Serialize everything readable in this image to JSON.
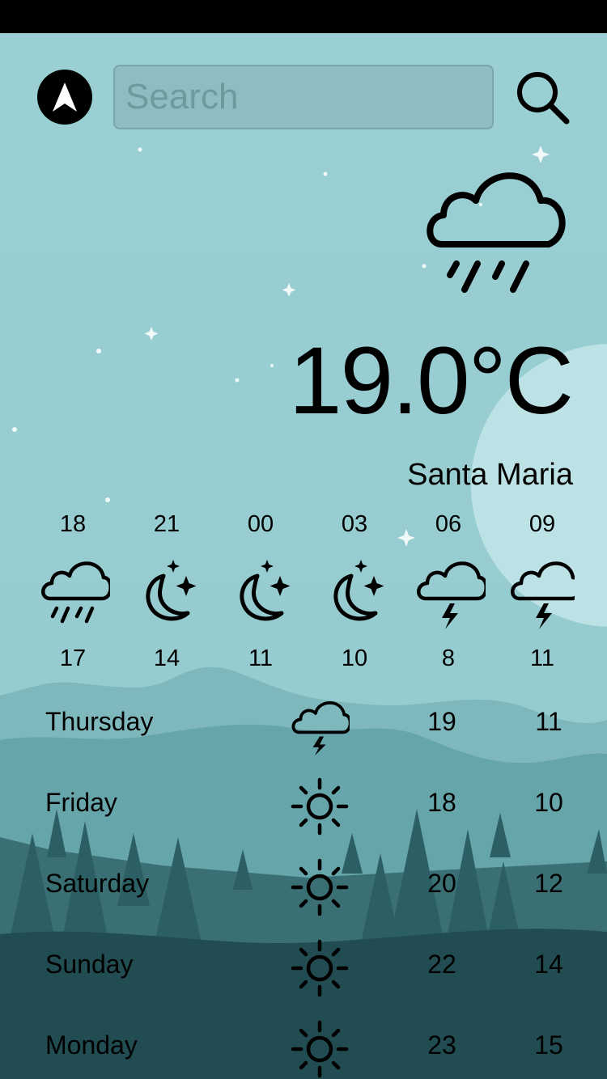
{
  "search": {
    "placeholder": "Search"
  },
  "current": {
    "temperature": "19.0°C",
    "city": "Santa Maria",
    "condition_icon": "rain-cloud-icon"
  },
  "hourly": [
    {
      "time": "18",
      "temp": "17",
      "icon": "rain-cloud-icon"
    },
    {
      "time": "21",
      "temp": "14",
      "icon": "moon-stars-icon"
    },
    {
      "time": "00",
      "temp": "11",
      "icon": "moon-stars-icon"
    },
    {
      "time": "03",
      "temp": "10",
      "icon": "moon-stars-icon"
    },
    {
      "time": "06",
      "temp": "8",
      "icon": "thunder-cloud-icon"
    },
    {
      "time": "09",
      "temp": "11",
      "icon": "thunder-cloud-icon"
    }
  ],
  "daily": [
    {
      "day": "Thursday",
      "high": "19",
      "low": "11",
      "icon": "thunder-cloud-icon"
    },
    {
      "day": "Friday",
      "high": "18",
      "low": "10",
      "icon": "sun-icon"
    },
    {
      "day": "Saturday",
      "high": "20",
      "low": "12",
      "icon": "sun-icon"
    },
    {
      "day": "Sunday",
      "high": "22",
      "low": "14",
      "icon": "sun-icon"
    },
    {
      "day": "Monday",
      "high": "23",
      "low": "15",
      "icon": "sun-icon"
    }
  ],
  "colors": {
    "sky": "#9ad0d3",
    "moon": "#bce2e5",
    "hills_far": "#78b2b6",
    "hills_mid": "#5f9ea3",
    "trees": "#2c5f64",
    "ground": "#1f4a4f"
  }
}
